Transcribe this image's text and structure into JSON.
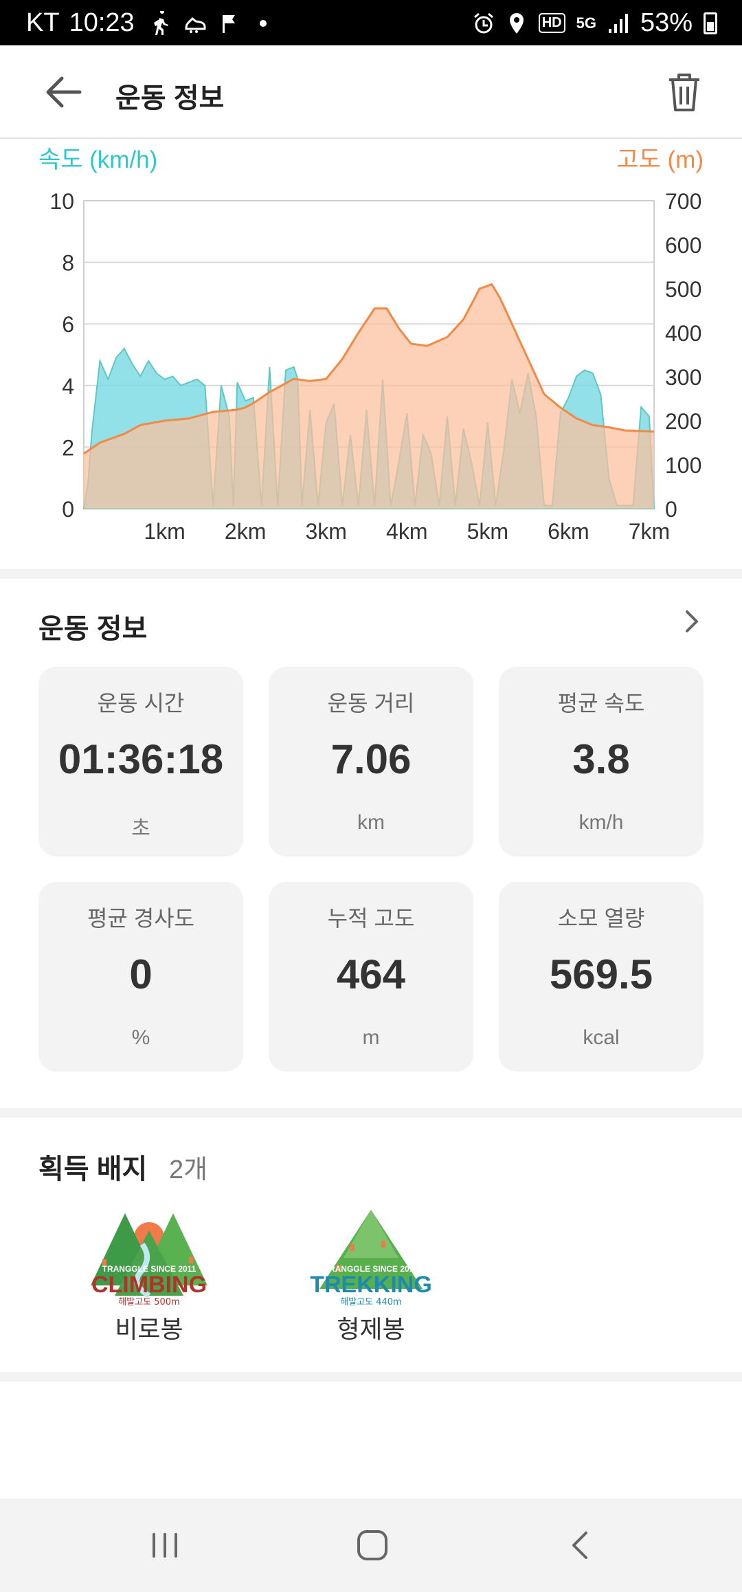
{
  "status_bar": {
    "carrier": "KT",
    "time": "10:23",
    "network_badges": [
      "HD",
      "5G"
    ],
    "battery": "53%"
  },
  "app_bar": {
    "title": "운동 정보",
    "back_icon": "arrow-left-icon",
    "trash_icon": "trash-icon"
  },
  "chart_data": {
    "type": "area",
    "left_axis_label": "속도 (km/h)",
    "right_axis_label": "고도 (m)",
    "left_ylim": [
      0,
      10
    ],
    "left_ticks": [
      "0",
      "2",
      "4",
      "6",
      "8",
      "10"
    ],
    "right_ylim": [
      0,
      700
    ],
    "right_ticks": [
      "0",
      "100",
      "200",
      "300",
      "400",
      "500",
      "600",
      "700"
    ],
    "xlim": [
      0,
      7.06
    ],
    "x_ticks": [
      "1km",
      "2km",
      "3km",
      "4km",
      "5km",
      "6km",
      "7km"
    ],
    "colors": {
      "speed": "#7fdbe4",
      "altitude": "#fbbf9c",
      "altitude_line": "#f28a45",
      "overlap": "#b5b29a"
    },
    "altitude": {
      "x": [
        0,
        0.2,
        0.5,
        0.7,
        1.0,
        1.3,
        1.6,
        1.9,
        2.0,
        2.1,
        2.3,
        2.6,
        2.8,
        3.0,
        3.2,
        3.4,
        3.6,
        3.75,
        3.9,
        4.05,
        4.25,
        4.5,
        4.7,
        4.9,
        5.05,
        5.15,
        5.3,
        5.5,
        5.7,
        5.9,
        6.1,
        6.3,
        6.5,
        6.7,
        7.06
      ],
      "y": [
        125,
        150,
        170,
        190,
        200,
        205,
        220,
        225,
        230,
        240,
        265,
        295,
        290,
        295,
        340,
        400,
        455,
        455,
        410,
        375,
        370,
        390,
        430,
        500,
        510,
        480,
        420,
        340,
        260,
        230,
        205,
        190,
        185,
        178,
        175
      ]
    },
    "speed": {
      "x": [
        0,
        0.05,
        0.1,
        0.2,
        0.3,
        0.4,
        0.5,
        0.6,
        0.7,
        0.8,
        0.9,
        1.0,
        1.1,
        1.2,
        1.3,
        1.4,
        1.5,
        1.6,
        1.7,
        1.8,
        1.85,
        1.9,
        2.0,
        2.1,
        2.2,
        2.3,
        2.4,
        2.5,
        2.6,
        2.65,
        2.7,
        2.8,
        2.9,
        3.0,
        3.1,
        3.2,
        3.3,
        3.4,
        3.5,
        3.6,
        3.7,
        3.8,
        3.9,
        4.0,
        4.1,
        4.2,
        4.3,
        4.4,
        4.5,
        4.6,
        4.7,
        4.8,
        4.9,
        5.0,
        5.1,
        5.2,
        5.3,
        5.4,
        5.5,
        5.6,
        5.7,
        5.8,
        5.9,
        6.0,
        6.1,
        6.2,
        6.3,
        6.4,
        6.5,
        6.6,
        6.7,
        6.8,
        6.9,
        7.0,
        7.06
      ],
      "y": [
        0,
        0.8,
        2.5,
        4.8,
        4.2,
        4.9,
        5.2,
        4.7,
        4.3,
        4.8,
        4.4,
        4.2,
        4.3,
        4.0,
        4.1,
        4.2,
        4.0,
        0.1,
        4.0,
        3.0,
        0.1,
        4.1,
        3.5,
        3.6,
        0.1,
        4.6,
        0.1,
        4.5,
        4.6,
        4.2,
        0.1,
        3.2,
        0.1,
        2.8,
        3.4,
        0.1,
        2.4,
        0.1,
        3.2,
        0.1,
        4.2,
        0.1,
        1.5,
        3.1,
        0.1,
        2.4,
        1.8,
        0.1,
        3.0,
        0.1,
        2.6,
        1.5,
        0.1,
        2.8,
        0.1,
        1.9,
        4.2,
        3.1,
        4.4,
        3.0,
        0.1,
        0.1,
        3.1,
        3.6,
        4.3,
        4.5,
        4.4,
        3.7,
        1.0,
        0.1,
        0.1,
        0.1,
        3.3,
        3.0,
        0
      ]
    }
  },
  "exercise": {
    "title": "운동 정보",
    "stats": [
      {
        "label": "운동 시간",
        "value": "01:36:18",
        "unit": "초"
      },
      {
        "label": "운동 거리",
        "value": "7.06",
        "unit": "km"
      },
      {
        "label": "평균 속도",
        "value": "3.8",
        "unit": "km/h"
      },
      {
        "label": "평균 경사도",
        "value": "0",
        "unit": "%"
      },
      {
        "label": "누적 고도",
        "value": "464",
        "unit": "m"
      },
      {
        "label": "소모 열량",
        "value": "569.5",
        "unit": "kcal"
      }
    ]
  },
  "badges": {
    "title": "획득 배지",
    "count": "2개",
    "items": [
      {
        "name": "비로봉",
        "type": "climbing",
        "logo_text": "CLIMBING",
        "banner": "TRANGGLE SINCE 2011",
        "sub": "해발고도 500m",
        "text_color": "#b0322b",
        "sun_color": "#f07a4a"
      },
      {
        "name": "형제봉",
        "type": "trekking",
        "logo_text": "TREKKING",
        "banner": "TRANGGLE SINCE 2011",
        "sub": "해발고도 440m",
        "text_color": "#1f8ab0",
        "sun_color": "#7cc36b"
      }
    ]
  },
  "nav_bar": {
    "recent_icon": "recent-apps-icon",
    "home_icon": "home-icon",
    "back_icon": "back-chevron-icon"
  }
}
